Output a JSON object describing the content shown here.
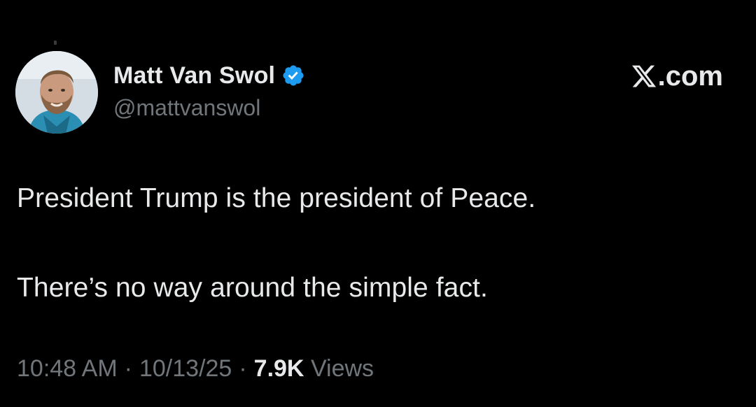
{
  "author": {
    "display_name": "Matt Van Swol",
    "handle": "@mattvanswol",
    "verified_icon": "verified-badge-icon",
    "avatar_icon": "profile-photo"
  },
  "brand": {
    "logo_icon": "x-logo-icon",
    "label": ".com"
  },
  "tweet": {
    "lines": [
      "President Trump is the president of Peace.",
      "There’s no way around the simple fact."
    ]
  },
  "meta": {
    "time": "10:48 AM",
    "separator": "·",
    "date": "10/13/25",
    "views_count": "7.9K",
    "views_label": "Views"
  },
  "colors": {
    "background": "#000000",
    "primary_text": "#e7e9ea",
    "secondary_text": "#71767b",
    "verified_blue": "#1d9bf0"
  }
}
